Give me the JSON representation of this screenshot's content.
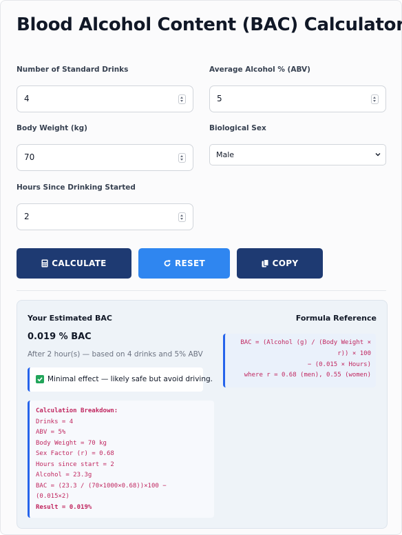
{
  "title": "Blood Alcohol Content (BAC) Calculator",
  "form": {
    "drinks": {
      "label": "Number of Standard Drinks",
      "value": "4"
    },
    "abv": {
      "label": "Average Alcohol % (ABV)",
      "value": "5"
    },
    "weight": {
      "label": "Body Weight (kg)",
      "value": "70"
    },
    "sex": {
      "label": "Biological Sex",
      "value": "Male"
    },
    "hours": {
      "label": "Hours Since Drinking Started",
      "value": "2"
    }
  },
  "buttons": {
    "calculate": "CALCULATE",
    "reset": "RESET",
    "copy": "COPY"
  },
  "colors": {
    "primary_dark": "#1e3a72",
    "primary_bright": "#2f86f0",
    "code_text": "#c0265f",
    "accent_border": "#2563eb"
  },
  "result": {
    "heading": "Your Estimated BAC",
    "bac_value": "0.019 % BAC",
    "summary": "After 2 hour(s) — based on 4 drinks and 5% ABV",
    "status": "Minimal effect — likely safe but avoid driving.",
    "breakdown": [
      "Calculation Breakdown:",
      "Drinks = 4",
      "ABV = 5%",
      "Body Weight = 70 kg",
      "Sex Factor (r) = 0.68",
      "Hours since start = 2",
      "Alcohol = 23.3g",
      "BAC = (23.3 / (70×1000×0.68))×100 −",
      "(0.015×2)",
      "Result = 0.019%"
    ]
  },
  "formula": {
    "heading": "Formula Reference",
    "lines": [
      "BAC = (Alcohol (g) / (Body Weight ×",
      "r)) × 100",
      "− (0.015 × Hours)",
      "where r = 0.68 (men), 0.55 (women)"
    ]
  }
}
